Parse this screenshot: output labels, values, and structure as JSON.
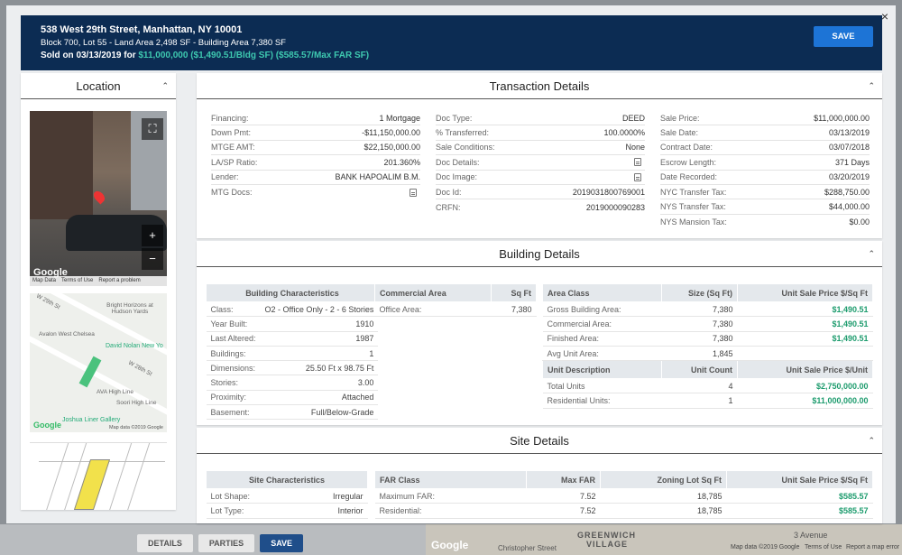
{
  "background": {
    "tabs": [
      "DETAILS",
      "PARTIES",
      "SAVE"
    ],
    "map_labels": [
      "GREENWICH",
      "VILLAGE",
      "3 Avenue"
    ],
    "map_google": "Google",
    "map_street": "Christopher Street",
    "map_footer": [
      "Map data ©2019 Google",
      "Terms of Use",
      "Report a map error"
    ]
  },
  "header": {
    "address": "538 West 29th Street, Manhattan, NY 10001",
    "subline": "Block 700, Lot 55 - Land Area 2,498 SF - Building Area 7,380 SF",
    "sold_prefix": "Sold on 03/13/2019 for ",
    "sold_values": "$11,000,000 ($1,490.51/Bldg SF) ($585.57/Max FAR SF)",
    "save_label": "SAVE",
    "close": "×"
  },
  "location": {
    "title": "Location",
    "street_footer": [
      "Map Data",
      "Terms of Use",
      "Report a problem"
    ],
    "google": "Google",
    "map_labels": {
      "w29": "W 29th St",
      "w28": "W 28th St",
      "bright": "Bright Horizons at Hudson Yards",
      "avalon": "Avalon West Chelsea",
      "nolan": "David Nolan New Yo",
      "ava": "AVA High Line",
      "soori": "Soori High Line",
      "joshua": "Joshua Liner Gallery",
      "mapdata": "Map data ©2019 Google"
    }
  },
  "transaction": {
    "title": "Transaction Details",
    "col1": [
      {
        "k": "Financing:",
        "v": "1 Mortgage"
      },
      {
        "k": "Down Pmt:",
        "v": "-$11,150,000.00"
      },
      {
        "k": "MTGE AMT:",
        "v": "$22,150,000.00"
      },
      {
        "k": "LA/SP Ratio:",
        "v": "201.360%"
      },
      {
        "k": "Lender:",
        "v": "BANK HAPOALIM B.M."
      },
      {
        "k": "MTG Docs:",
        "v": ""
      }
    ],
    "col2": [
      {
        "k": "Doc Type:",
        "v": "DEED"
      },
      {
        "k": "% Transferred:",
        "v": "100.0000%"
      },
      {
        "k": "Sale Conditions:",
        "v": "None"
      },
      {
        "k": "Doc Details:",
        "v": ""
      },
      {
        "k": "Doc Image:",
        "v": ""
      },
      {
        "k": "Doc Id:",
        "v": "2019031800769001"
      },
      {
        "k": "CRFN:",
        "v": "2019000090283"
      }
    ],
    "col3": [
      {
        "k": "Sale Price:",
        "v": "$11,000,000.00"
      },
      {
        "k": "Sale Date:",
        "v": "03/13/2019"
      },
      {
        "k": "Contract Date:",
        "v": "03/07/2018"
      },
      {
        "k": "Escrow Length:",
        "v": "371 Days"
      },
      {
        "k": "Date Recorded:",
        "v": "03/20/2019"
      },
      {
        "k": "NYC Transfer Tax:",
        "v": "$288,750.00"
      },
      {
        "k": "NYS Transfer Tax:",
        "v": "$44,000.00"
      },
      {
        "k": "NYS Mansion Tax:",
        "v": "$0.00"
      }
    ]
  },
  "building": {
    "title": "Building Details",
    "characteristics_header": "Building Characteristics",
    "characteristics": [
      {
        "k": "Class:",
        "v": "O2 - Office Only - 2 - 6 Stories"
      },
      {
        "k": "Year Built:",
        "v": "1910"
      },
      {
        "k": "Last Altered:",
        "v": "1987"
      },
      {
        "k": "Buildings:",
        "v": "1"
      },
      {
        "k": "Dimensions:",
        "v": "25.50 Ft x 98.75 Ft"
      },
      {
        "k": "Stories:",
        "v": "3.00"
      },
      {
        "k": "Proximity:",
        "v": "Attached"
      },
      {
        "k": "Basement:",
        "v": "Full/Below-Grade"
      }
    ],
    "commercial_headers": [
      "Commercial Area",
      "Sq Ft"
    ],
    "commercial": [
      {
        "k": "Office Area:",
        "v": "7,380"
      }
    ],
    "area_headers": [
      "Area Class",
      "Size (Sq Ft)",
      "Unit Sale Price $/Sq Ft"
    ],
    "area": [
      {
        "k": "Gross Building Area:",
        "size": "7,380",
        "price": "$1,490.51"
      },
      {
        "k": "Commercial Area:",
        "size": "7,380",
        "price": "$1,490.51"
      },
      {
        "k": "Finished Area:",
        "size": "7,380",
        "price": "$1,490.51"
      },
      {
        "k": "Avg Unit Area:",
        "size": "1,845",
        "price": ""
      }
    ],
    "unit_headers": [
      "Unit Description",
      "Unit Count",
      "Unit Sale Price $/Unit"
    ],
    "units": [
      {
        "k": "Total Units",
        "count": "4",
        "price": "$2,750,000.00"
      },
      {
        "k": "Residential Units:",
        "count": "1",
        "price": "$11,000,000.00"
      }
    ]
  },
  "site": {
    "title": "Site Details",
    "characteristics_header": "Site Characteristics",
    "characteristics": [
      {
        "k": "Lot Shape:",
        "v": "Irregular"
      },
      {
        "k": "Lot Type:",
        "v": "Interior"
      }
    ],
    "far_headers": [
      "FAR Class",
      "Max FAR",
      "Zoning Lot Sq Ft",
      "Unit Sale Price $/Sq Ft"
    ],
    "far": [
      {
        "k": "Maximum FAR:",
        "max": "7.52",
        "zoning": "18,785",
        "price": "$585.57"
      },
      {
        "k": "Residential:",
        "max": "7.52",
        "zoning": "18,785",
        "price": "$585.57"
      }
    ]
  }
}
